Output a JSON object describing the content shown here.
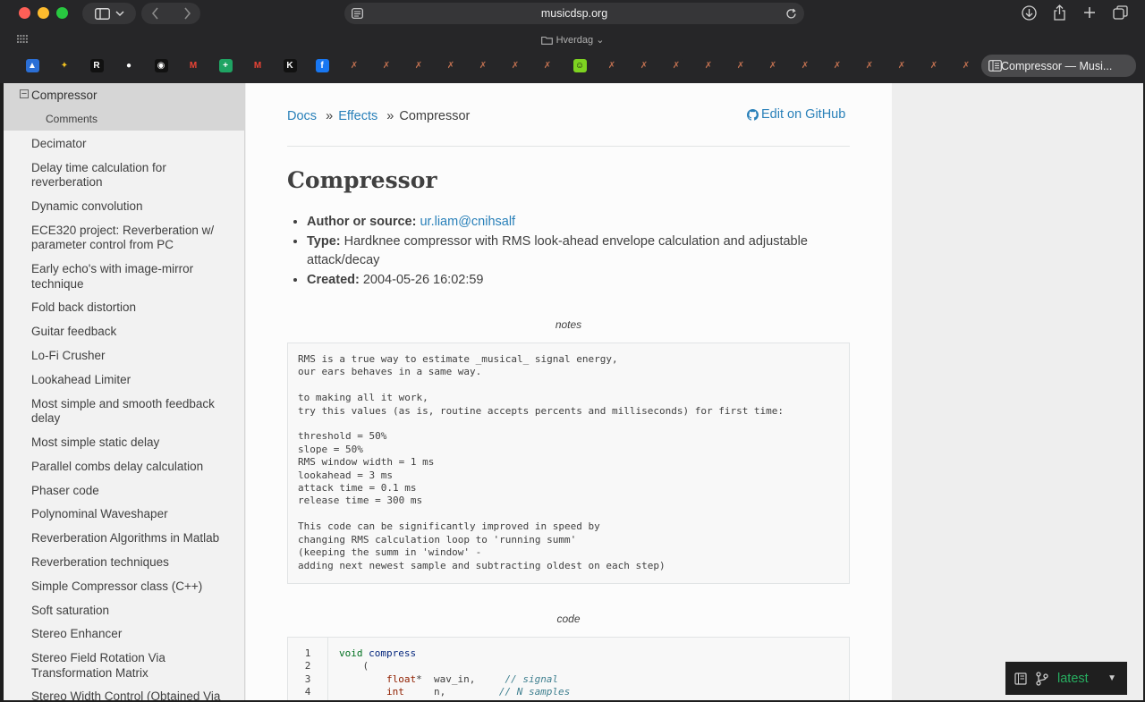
{
  "browser": {
    "address": "musicdsp.org",
    "tab_group": "Hverdag",
    "active_tab_title": "Compressor — Musi...",
    "favicons": [
      {
        "name": "photos-favicon",
        "bg": "#2b6fd6",
        "glyph": "▲"
      },
      {
        "name": "bee-favicon",
        "bg": "#262628",
        "glyph": "✦",
        "fg": "#f0c020"
      },
      {
        "name": "r-favicon",
        "bg": "#111111",
        "glyph": "R"
      },
      {
        "name": "github-favicon",
        "bg": "#262628",
        "glyph": "●"
      },
      {
        "name": "app-favicon",
        "bg": "#111111",
        "glyph": "◉"
      },
      {
        "name": "gmail-favicon",
        "bg": "#262628",
        "glyph": "M",
        "fg": "#ea4335"
      },
      {
        "name": "sheets-favicon",
        "bg": "#1fa463",
        "glyph": "+"
      },
      {
        "name": "gmail-favicon-2",
        "bg": "#262628",
        "glyph": "M",
        "fg": "#ea4335"
      },
      {
        "name": "k-favicon",
        "bg": "#111111",
        "glyph": "K"
      },
      {
        "name": "facebook-favicon",
        "bg": "#1877f2",
        "glyph": "f"
      },
      {
        "name": "x-favicon",
        "bg": "#262628",
        "glyph": "✗",
        "fg": "#c07050"
      },
      {
        "name": "x-favicon",
        "bg": "#262628",
        "glyph": "✗",
        "fg": "#c07050"
      },
      {
        "name": "x-favicon",
        "bg": "#262628",
        "glyph": "✗",
        "fg": "#c07050"
      },
      {
        "name": "x-favicon",
        "bg": "#262628",
        "glyph": "✗",
        "fg": "#c07050"
      },
      {
        "name": "x-favicon",
        "bg": "#262628",
        "glyph": "✗",
        "fg": "#c07050"
      },
      {
        "name": "x-favicon",
        "bg": "#262628",
        "glyph": "✗",
        "fg": "#c07050"
      },
      {
        "name": "x-favicon",
        "bg": "#262628",
        "glyph": "✗",
        "fg": "#c07050"
      },
      {
        "name": "smiley-favicon",
        "bg": "#7ed321",
        "glyph": "☺",
        "fg": "#111"
      },
      {
        "name": "x-favicon",
        "bg": "#262628",
        "glyph": "✗",
        "fg": "#c07050"
      },
      {
        "name": "x-favicon",
        "bg": "#262628",
        "glyph": "✗",
        "fg": "#c07050"
      },
      {
        "name": "x-favicon",
        "bg": "#262628",
        "glyph": "✗",
        "fg": "#c07050"
      },
      {
        "name": "x-favicon",
        "bg": "#262628",
        "glyph": "✗",
        "fg": "#c07050"
      },
      {
        "name": "x-favicon",
        "bg": "#262628",
        "glyph": "✗",
        "fg": "#c07050"
      },
      {
        "name": "x-favicon",
        "bg": "#262628",
        "glyph": "✗",
        "fg": "#c07050"
      },
      {
        "name": "x-favicon",
        "bg": "#262628",
        "glyph": "✗",
        "fg": "#c07050"
      },
      {
        "name": "x-favicon",
        "bg": "#262628",
        "glyph": "✗",
        "fg": "#c07050"
      },
      {
        "name": "x-favicon",
        "bg": "#262628",
        "glyph": "✗",
        "fg": "#c07050"
      },
      {
        "name": "x-favicon",
        "bg": "#262628",
        "glyph": "✗",
        "fg": "#c07050"
      },
      {
        "name": "x-favicon",
        "bg": "#262628",
        "glyph": "✗",
        "fg": "#c07050"
      },
      {
        "name": "x-favicon",
        "bg": "#262628",
        "glyph": "✗",
        "fg": "#c07050"
      }
    ]
  },
  "sidebar": {
    "current": "Compressor",
    "current_sub": "Comments",
    "items": [
      "Decimator",
      "Delay time calculation for reverberation",
      "Dynamic convolution",
      "ECE320 project: Reverberation w/ parameter control from PC",
      "Early echo's with image-mirror technique",
      "Fold back distortion",
      "Guitar feedback",
      "Lo-Fi Crusher",
      "Lookahead Limiter",
      "Most simple and smooth feedback delay",
      "Most simple static delay",
      "Parallel combs delay calculation",
      "Phaser code",
      "Polynominal Waveshaper",
      "Reverberation Algorithms in Matlab",
      "Reverberation techniques",
      "Simple Compressor class (C++)",
      "Soft saturation",
      "Stereo Enhancer",
      "Stereo Field Rotation Via Transformation Matrix",
      "Stereo Width Control (Obtained Via"
    ]
  },
  "breadcrumb": {
    "docs": "Docs",
    "sep": "»",
    "effects": "Effects",
    "current": "Compressor",
    "edit": "Edit on GitHub"
  },
  "article": {
    "title": "Compressor",
    "author_label": "Author or source:",
    "author": "ur.liam@cnihsalf",
    "type_label": "Type:",
    "type": "Hardknee compressor with RMS look-ahead envelope calculation and adjustable attack/decay",
    "created_label": "Created:",
    "created": "2004-05-26 16:02:59",
    "notes_caption": "notes",
    "notes": "RMS is a true way to estimate _musical_ signal energy,\nour ears behaves in a same way.\n\nto making all it work,\ntry this values (as is, routine accepts percents and milliseconds) for first time:\n\nthreshold = 50%\nslope = 50%\nRMS window width = 1 ms\nlookahead = 3 ms\nattack time = 0.1 ms\nrelease time = 300 ms\n\nThis code can be significantly improved in speed by\nchanging RMS calculation loop to 'running summ'\n(keeping the summ in 'window' -\nadding next newest sample and subtracting oldest on each step)",
    "code_caption": "code",
    "code_lines": [
      {
        "n": "1",
        "parts": [
          [
            "kw",
            "void"
          ],
          [
            "",
            " "
          ],
          [
            "fn",
            "compress"
          ]
        ]
      },
      {
        "n": "2",
        "parts": [
          [
            "",
            "    ("
          ]
        ]
      },
      {
        "n": "3",
        "parts": [
          [
            "",
            "        "
          ],
          [
            "ty",
            "float"
          ],
          [
            "",
            "*  wav_in,     "
          ],
          [
            "cm",
            "// signal"
          ]
        ]
      },
      {
        "n": "4",
        "parts": [
          [
            "",
            "        "
          ],
          [
            "ty",
            "int"
          ],
          [
            "",
            "     n,         "
          ],
          [
            "cm",
            "// N samples"
          ]
        ]
      }
    ]
  },
  "versions": {
    "label": "latest"
  }
}
